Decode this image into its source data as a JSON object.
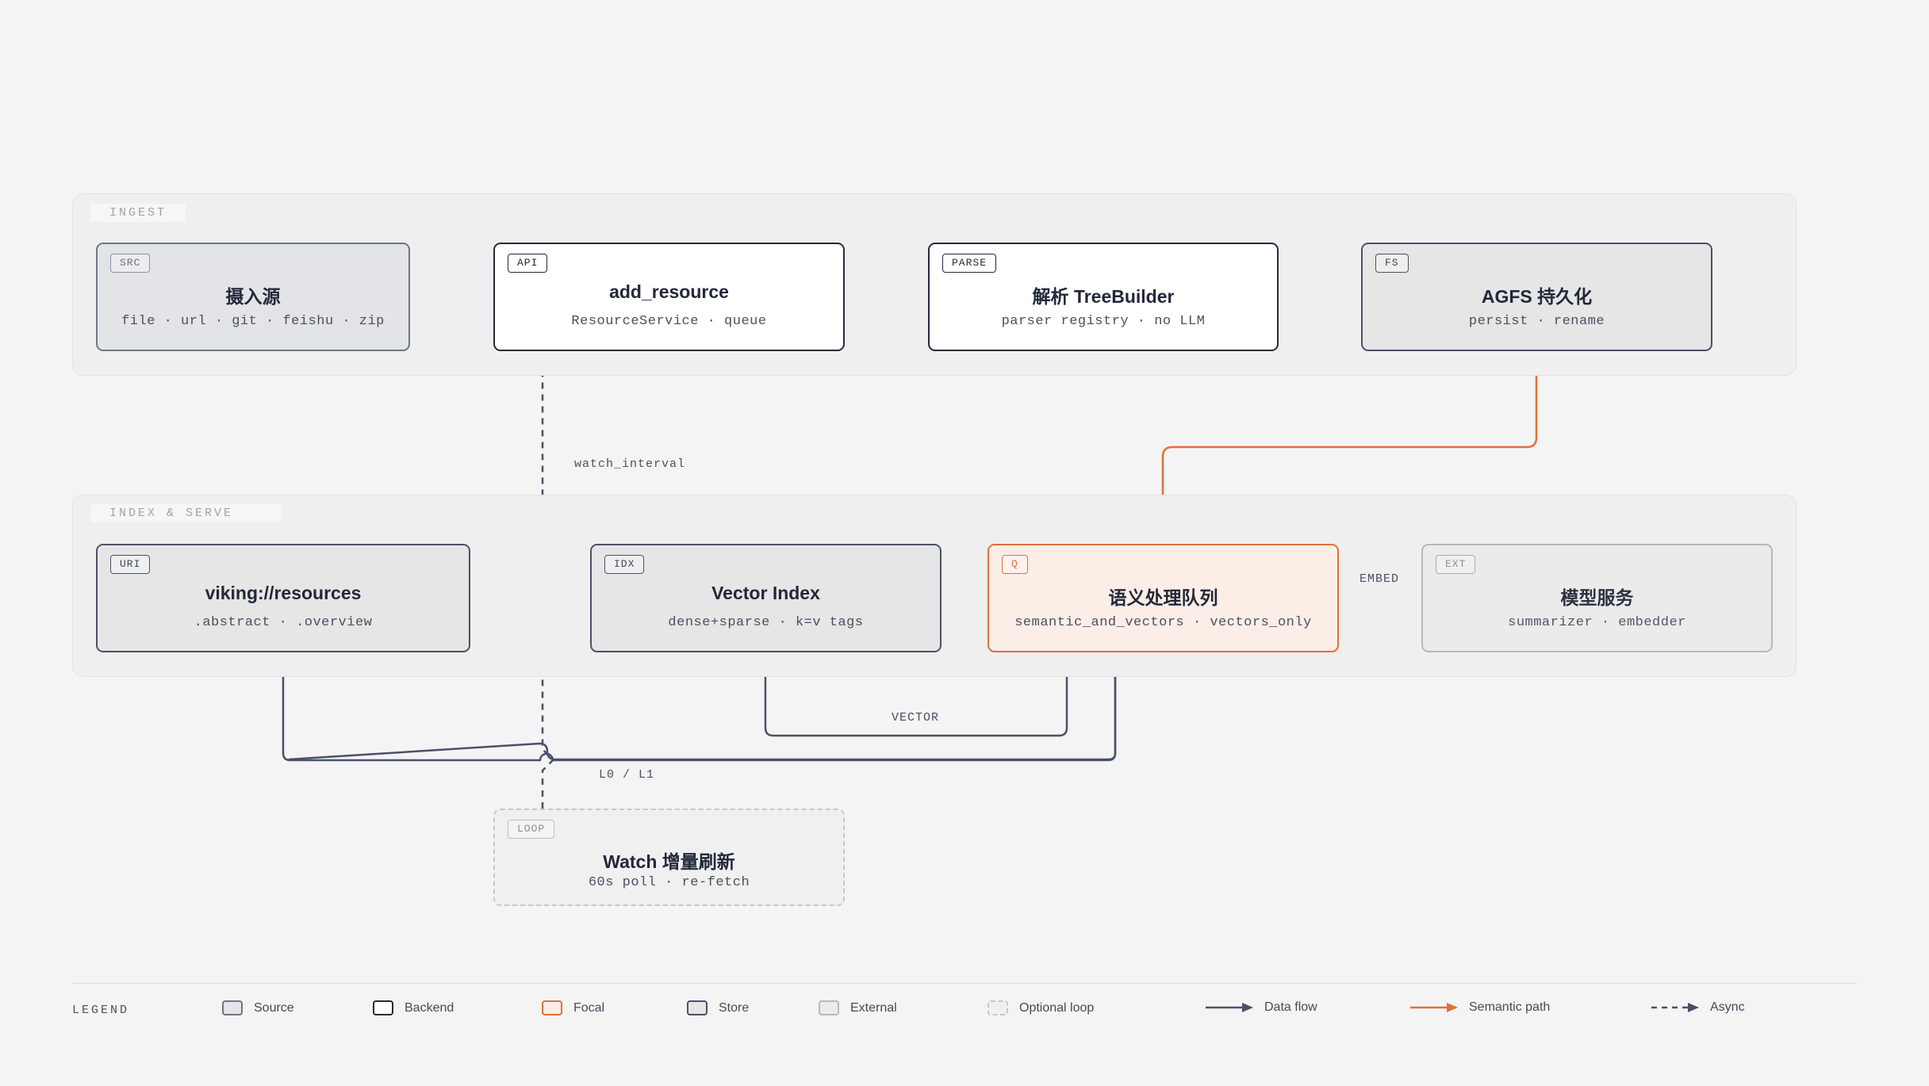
{
  "groups": {
    "ingest": "INGEST",
    "index_serve": "INDEX & SERVE"
  },
  "nodes": {
    "src": {
      "tag": "SRC",
      "title": "摄入源",
      "sub": "file · url · git · feishu · zip"
    },
    "api": {
      "tag": "API",
      "title": "add_resource",
      "sub": "ResourceService · queue"
    },
    "parse": {
      "tag": "PARSE",
      "title": "解析 TreeBuilder",
      "sub": "parser registry · no LLM"
    },
    "fs": {
      "tag": "FS",
      "title": "AGFS 持久化",
      "sub": "persist · rename"
    },
    "uri": {
      "tag": "URI",
      "title": "viking://resources",
      "sub": ".abstract · .overview"
    },
    "idx": {
      "tag": "IDX",
      "title": "Vector Index",
      "sub": "dense+sparse · k=v tags"
    },
    "q": {
      "tag": "Q",
      "title": "语义处理队列",
      "sub": "semantic_and_vectors · vectors_only"
    },
    "ext": {
      "tag": "EXT",
      "title": "模型服务",
      "sub": "summarizer · embedder"
    },
    "loop": {
      "tag": "LOOP",
      "title": "Watch 增量刷新",
      "sub": "60s poll · re-fetch"
    }
  },
  "edge_labels": {
    "watch_interval": "watch_interval",
    "embed": "EMBED",
    "vector": "VECTOR",
    "l0l1": "L0 / L1"
  },
  "legend": {
    "title": "LEGEND",
    "source": "Source",
    "backend": "Backend",
    "focal": "Focal",
    "store": "Store",
    "external": "External",
    "optional_loop": "Optional loop",
    "data_flow": "Data flow",
    "semantic_path": "Semantic path",
    "async": "Async"
  },
  "colors": {
    "data_flow": "#4a5168",
    "semantic_path": "#e0703a",
    "async": "#4a5168"
  }
}
